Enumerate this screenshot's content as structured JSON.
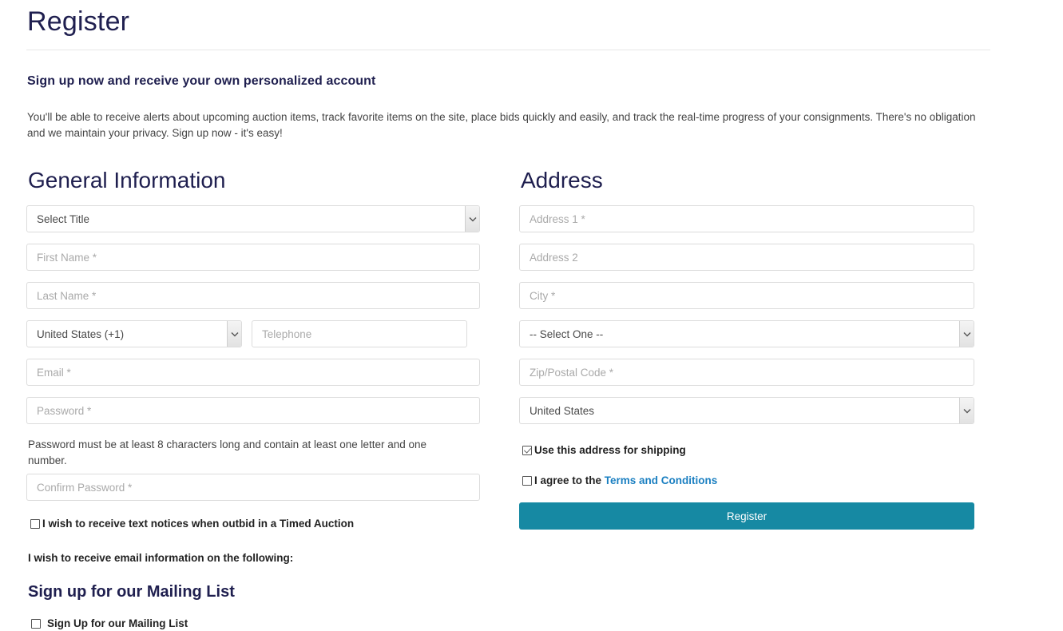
{
  "header": {
    "title": "Register",
    "subtitle": "Sign up now and receive your own personalized account",
    "intro": "You'll be able to receive alerts about upcoming auction items, track favorite items on the site, place bids quickly and easily, and track the real-time progress of your consignments. There's no obligation and we maintain your privacy. Sign up now - it's easy!"
  },
  "general": {
    "heading": "General Information",
    "title_select": {
      "selected": "Select Title",
      "options": [
        "Select Title"
      ]
    },
    "first_name_placeholder": "First Name *",
    "last_name_placeholder": "Last Name *",
    "country_code_select": {
      "selected": "United States (+1)",
      "options": [
        "United States (+1)"
      ]
    },
    "telephone_placeholder": "Telephone",
    "email_placeholder": "Email *",
    "password_placeholder": "Password *",
    "password_hint": "Password must be at least 8 characters long and contain at least one letter and one number.",
    "confirm_password_placeholder": "Confirm Password *",
    "text_notice_label": "I wish to receive text notices when outbid in a Timed Auction",
    "text_notice_checked": false,
    "email_info_note": "I wish to receive email information on the following:",
    "mailing_heading": "Sign up for our Mailing List",
    "mailing_checkbox_label": "Sign Up for our Mailing List",
    "mailing_checked": false
  },
  "address": {
    "heading": "Address",
    "address1_placeholder": "Address 1 *",
    "address2_placeholder": "Address 2",
    "city_placeholder": "City *",
    "state_select": {
      "selected": "-- Select One --",
      "options": [
        "-- Select One --"
      ]
    },
    "zip_placeholder": "Zip/Postal Code *",
    "country_select": {
      "selected": "United States",
      "options": [
        "United States"
      ]
    },
    "shipping_label": "Use this address for shipping",
    "shipping_checked": true,
    "terms_prefix": "I agree to the ",
    "terms_link": "Terms and Conditions",
    "terms_checked": false,
    "register_button": "Register"
  },
  "colors": {
    "heading_navy": "#1f1f4f",
    "button_teal": "#1689a3",
    "link_blue": "#1a7fc1",
    "border_grey": "#dcdcdc",
    "placeholder_grey": "#aaaaaa"
  }
}
